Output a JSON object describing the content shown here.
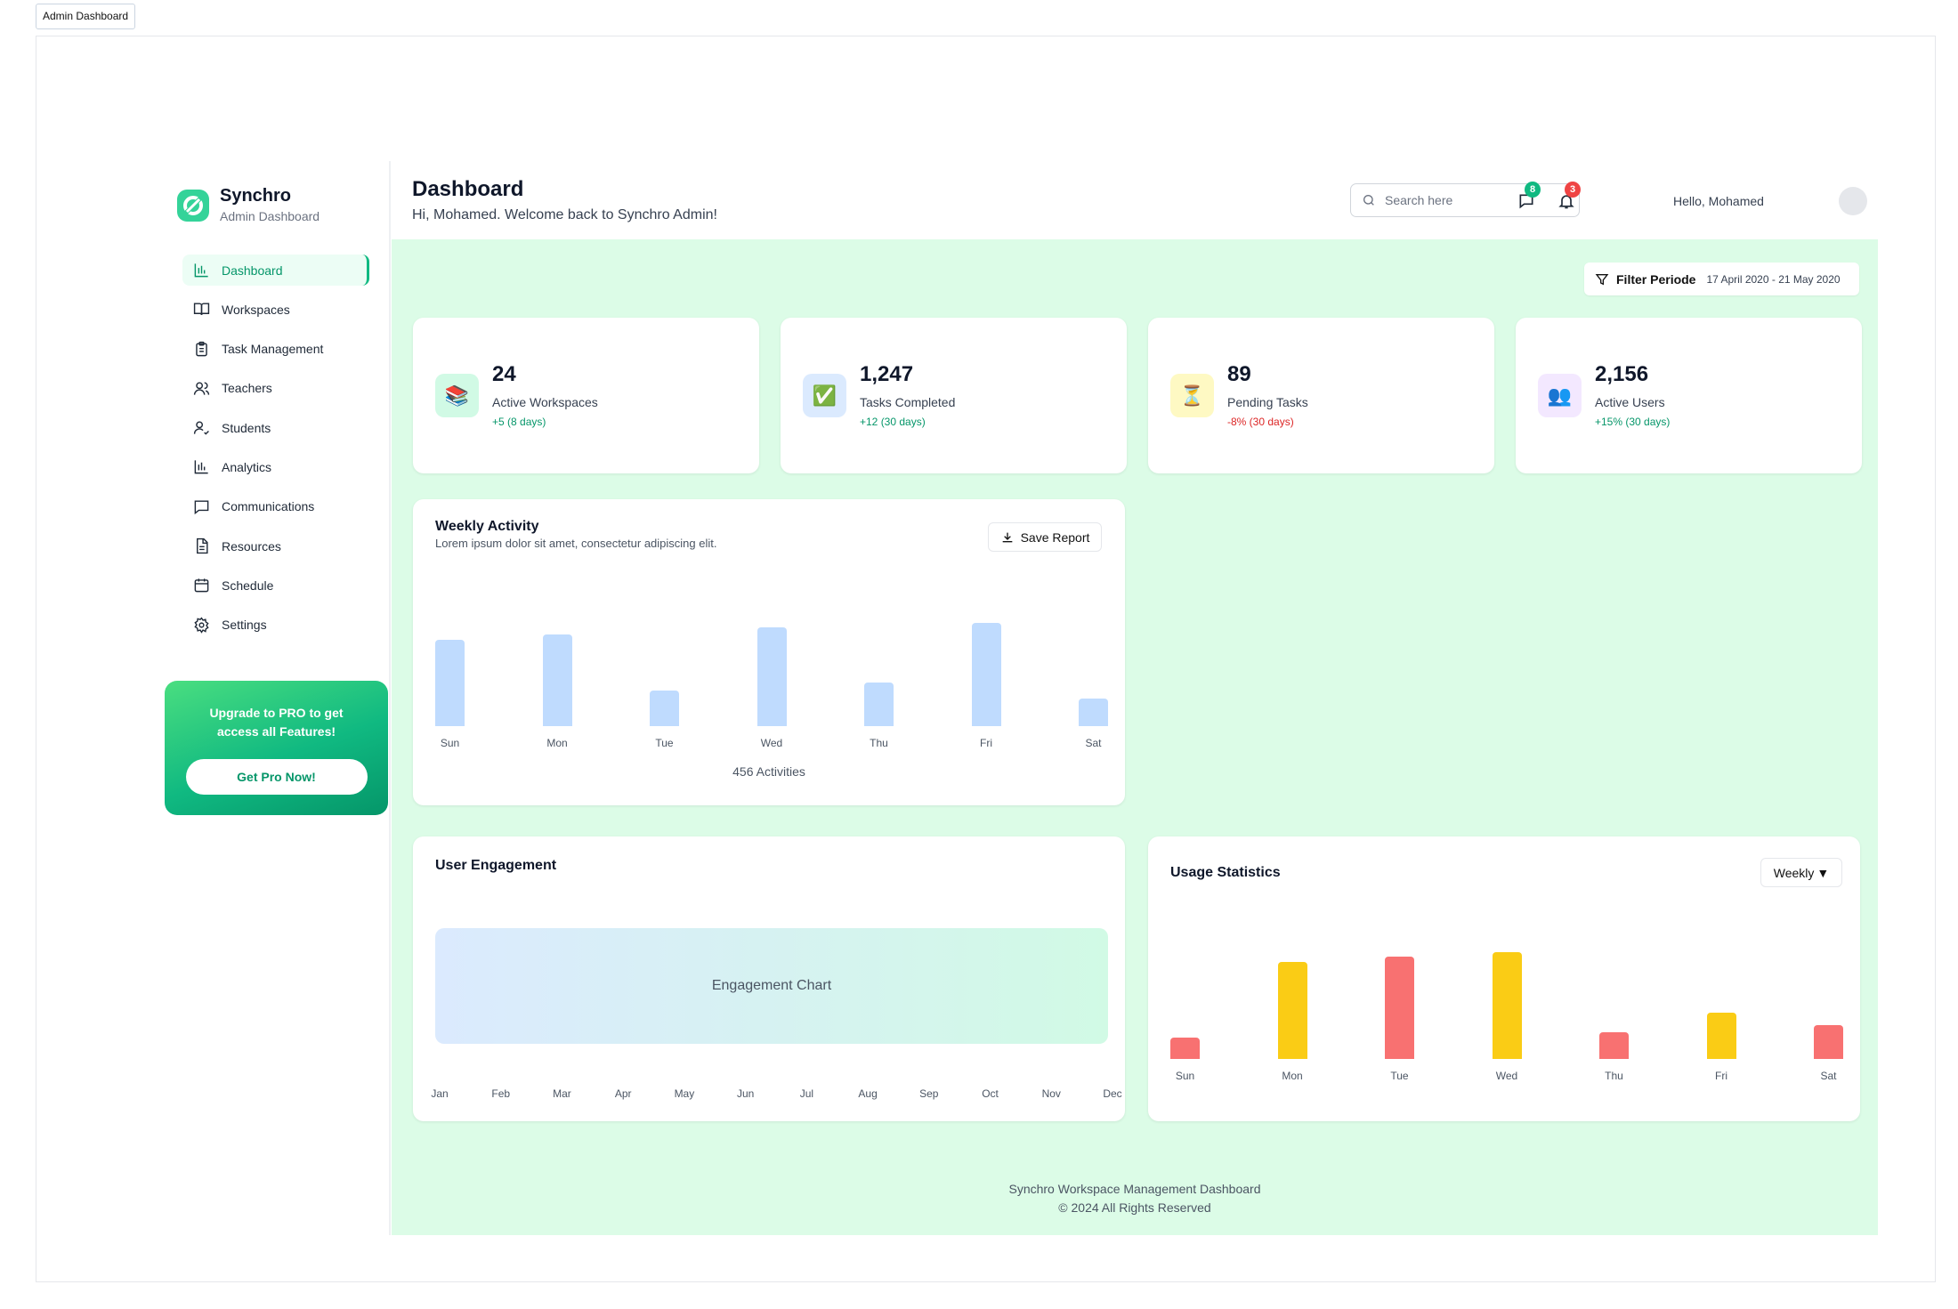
{
  "window": {
    "tab_label": "Admin Dashboard"
  },
  "brand": {
    "name": "Synchro",
    "subtitle": "Admin Dashboard",
    "accent": "#10b981"
  },
  "sidebar": {
    "items": [
      {
        "label": "Dashboard",
        "icon": "bar-chart-icon",
        "active": true
      },
      {
        "label": "Workspaces",
        "icon": "book-open-icon"
      },
      {
        "label": "Task Management",
        "icon": "clipboard-icon"
      },
      {
        "label": "Teachers",
        "icon": "users-icon"
      },
      {
        "label": "Students",
        "icon": "user-check-icon"
      },
      {
        "label": "Analytics",
        "icon": "bar-chart-icon"
      },
      {
        "label": "Communications",
        "icon": "message-square-icon"
      },
      {
        "label": "Resources",
        "icon": "file-text-icon"
      },
      {
        "label": "Schedule",
        "icon": "calendar-icon"
      },
      {
        "label": "Settings",
        "icon": "gear-icon"
      }
    ],
    "promo": {
      "text": "Upgrade to  PRO to get access all Features!",
      "button": "Get Pro Now!"
    }
  },
  "header": {
    "title": "Dashboard",
    "subtitle": "Hi, Mohamed. Welcome back to Synchro Admin!",
    "search_placeholder": "Search here",
    "messages_count": "8",
    "notifications_count": "3",
    "greeting": "Hello, Mohamed"
  },
  "filter": {
    "label": "Filter Periode",
    "range": "17 April 2020 - 21 May 2020"
  },
  "stats": [
    {
      "value": "24",
      "label": "Active Workspaces",
      "change": "+5 (8 days)",
      "icon": "📚",
      "icon_name": "books-icon",
      "bg": "#d1fae5",
      "change_color": "#059669"
    },
    {
      "value": "1,247",
      "label": "Tasks Completed",
      "change": "+12 (30 days)",
      "icon": "✅",
      "icon_name": "check-icon",
      "bg": "#dbeafe",
      "change_color": "#059669"
    },
    {
      "value": "89",
      "label": "Pending Tasks",
      "change": "-8% (30 days)",
      "icon": "⏳",
      "icon_name": "hourglass-icon",
      "bg": "#fef9c3",
      "change_color": "#dc2626"
    },
    {
      "value": "2,156",
      "label": "Active Users",
      "change": "+15% (30 days)",
      "icon": "👥",
      "icon_name": "users-group-icon",
      "bg": "#f3e8ff",
      "change_color": "#059669"
    }
  ],
  "weekly": {
    "title": "Weekly Activity",
    "subtitle": "Lorem ipsum dolor sit amet, consectetur adipiscing elit.",
    "save_label": "Save Report",
    "total": "456 Activities"
  },
  "engagement": {
    "title": "User Engagement",
    "placeholder": "Engagement Chart",
    "months": [
      "Jan",
      "Feb",
      "Mar",
      "Apr",
      "May",
      "Jun",
      "Jul",
      "Aug",
      "Sep",
      "Oct",
      "Nov",
      "Dec"
    ]
  },
  "usage": {
    "title": "Usage Statistics",
    "period": "Weekly"
  },
  "footer": {
    "line1": "Synchro Workspace Management Dashboard",
    "line2": "© 2024 All Rights Reserved"
  },
  "chart_data": [
    {
      "type": "bar",
      "categories": [
        "Sun",
        "Mon",
        "Tue",
        "Wed",
        "Thu",
        "Fri",
        "Sat"
      ],
      "values": [
        72,
        76,
        30,
        82,
        36,
        86,
        23
      ],
      "color": "#bfdbfe"
    },
    {
      "type": "bar",
      "categories": [
        "Sun",
        "Mon",
        "Tue",
        "Wed",
        "Thu",
        "Fri",
        "Sat"
      ],
      "values": [
        19,
        88,
        93,
        97,
        24,
        42,
        31
      ],
      "colors": [
        "#f87171",
        "#facc15",
        "#f87171",
        "#facc15",
        "#f87171",
        "#facc15",
        "#f87171"
      ]
    }
  ]
}
